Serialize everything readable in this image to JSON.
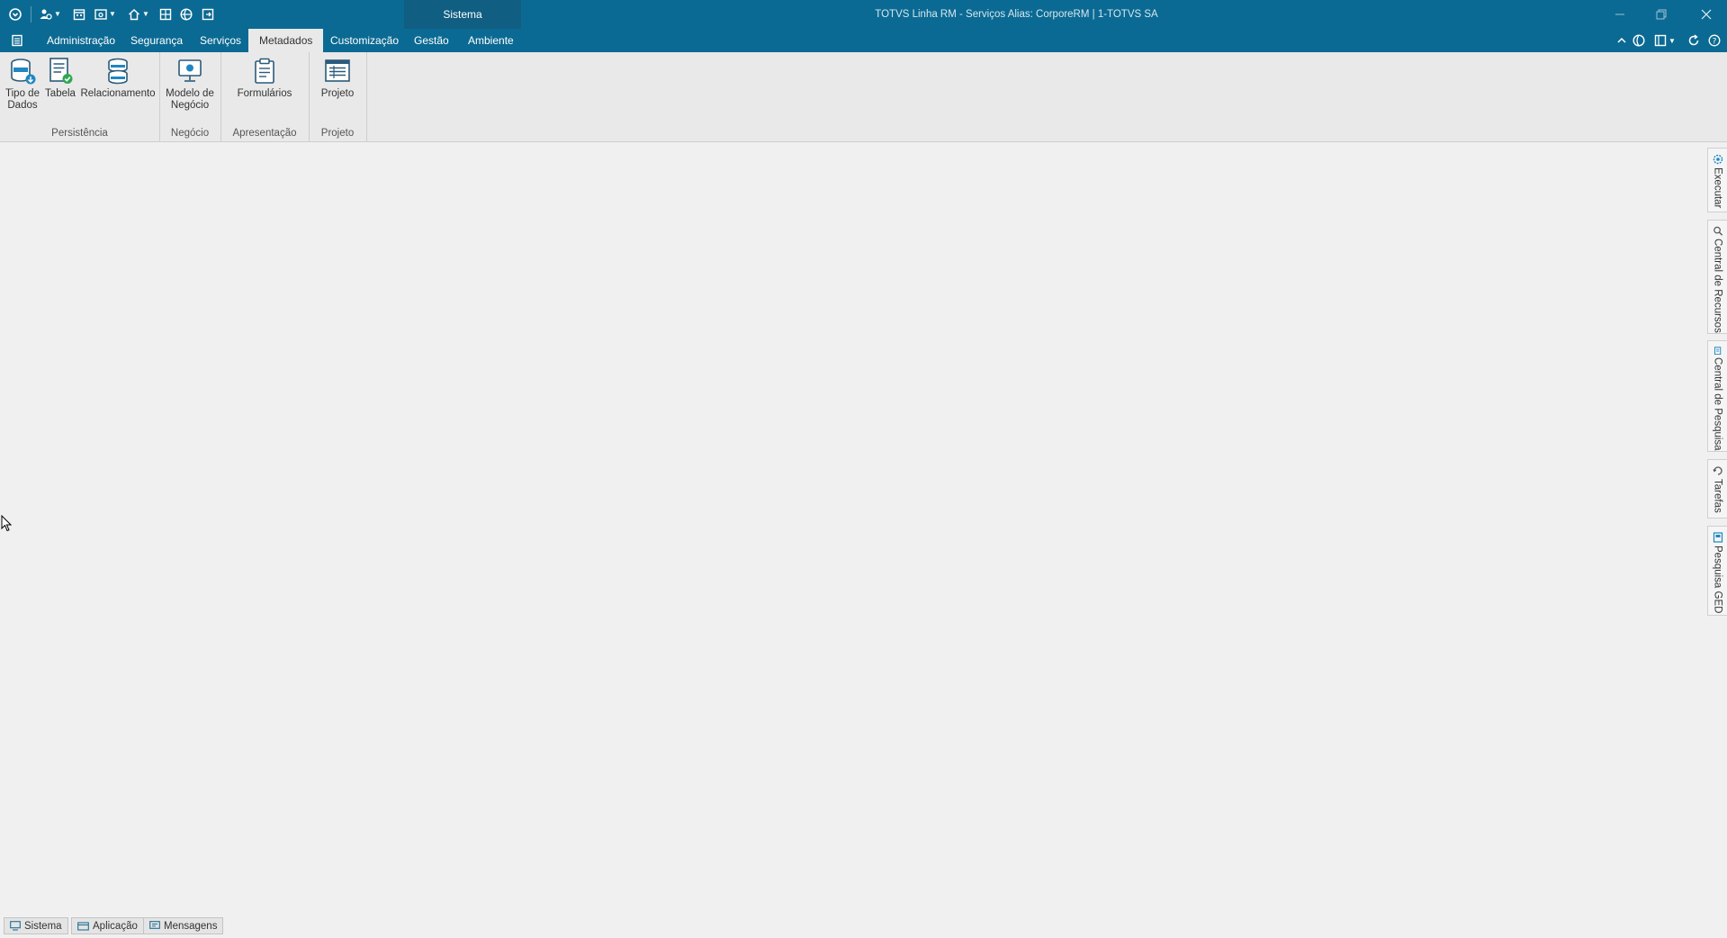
{
  "titlebar": {
    "context_tab": "Sistema",
    "window_title": "TOTVS Linha RM - Serviços  Alias: CorporeRM | 1-TOTVS SA"
  },
  "tabs": [
    {
      "label": "Administração",
      "active": false
    },
    {
      "label": "Segurança",
      "active": false
    },
    {
      "label": "Serviços",
      "active": false
    },
    {
      "label": "Metadados",
      "active": true
    },
    {
      "label": "Customização",
      "active": false
    },
    {
      "label": "Gestão",
      "active": false
    },
    {
      "label": "Ambiente",
      "active": false
    }
  ],
  "ribbon": {
    "groups": [
      {
        "label": "Persistência",
        "buttons": [
          {
            "label": "Tipo de\nDados",
            "icon": "database-icon"
          },
          {
            "label": "Tabela",
            "icon": "table-check-icon"
          },
          {
            "label": "Relacionamento",
            "icon": "relationship-icon"
          }
        ]
      },
      {
        "label": "Negócio",
        "buttons": [
          {
            "label": "Modelo de\nNegócio",
            "icon": "business-model-icon"
          }
        ]
      },
      {
        "label": "Apresentação",
        "buttons": [
          {
            "label": "Formulários",
            "icon": "form-icon"
          }
        ]
      },
      {
        "label": "Projeto",
        "buttons": [
          {
            "label": "Projeto",
            "icon": "project-icon"
          }
        ]
      }
    ]
  },
  "side_dock": [
    {
      "label": "Executar",
      "icon": "gear-icon"
    },
    {
      "label": "Central de Recursos",
      "icon": "search-icon"
    },
    {
      "label": "Central de Pesquisa",
      "icon": "document-search-icon"
    },
    {
      "label": "Tarefas",
      "icon": "task-icon"
    },
    {
      "label": "Pesquisa GED",
      "icon": "ged-icon"
    }
  ],
  "statusbar": [
    {
      "label": "Sistema",
      "icon": "monitor-icon"
    },
    {
      "label": "Aplicação",
      "icon": "app-icon"
    },
    {
      "label": "Mensagens",
      "icon": "message-icon"
    }
  ],
  "colors": {
    "titlebar": "#0b6a93",
    "context_tab": "#105e82",
    "ribbon_bg": "#e9e9e9",
    "workspace_bg": "#f0f0f0"
  }
}
